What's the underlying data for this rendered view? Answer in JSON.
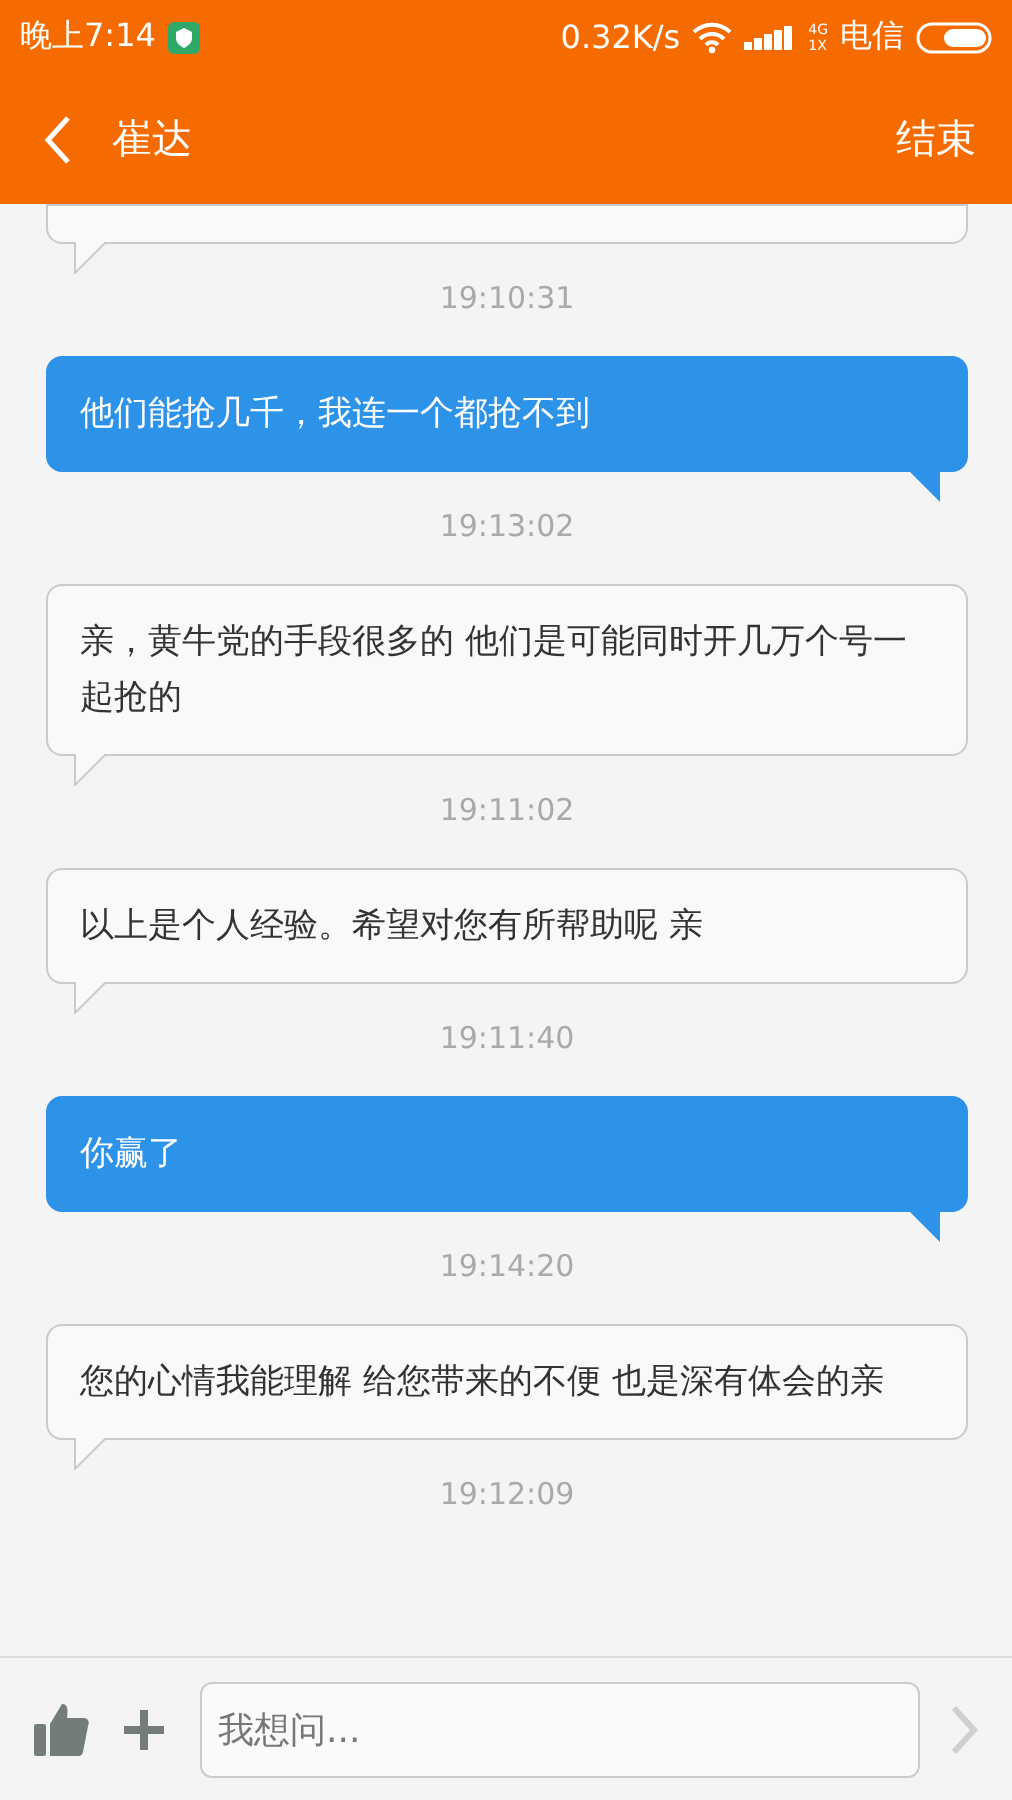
{
  "status_bar": {
    "time": "晚上7:14",
    "speed": "0.32K/s",
    "network_top": "4G",
    "network_bottom": "1X",
    "carrier": "电信"
  },
  "header": {
    "title": "崔达",
    "action": "结束"
  },
  "messages": [
    {
      "kind": "in",
      "time": "19:10:31"
    },
    {
      "kind": "out",
      "text": "他们能抢几千，我连一个都抢不到",
      "time": "19:13:02"
    },
    {
      "kind": "in",
      "text": "亲，黄牛党的手段很多的 他们是可能同时开几万个号一起抢的",
      "time": "19:11:02"
    },
    {
      "kind": "in",
      "text": "以上是个人经验。希望对您有所帮助呢 亲",
      "time": "19:11:40"
    },
    {
      "kind": "out",
      "text": "你赢了",
      "time": "19:14:20"
    },
    {
      "kind": "in",
      "text": "您的心情我能理解 给您带来的不便 也是深有体会的亲",
      "time": "19:12:09"
    }
  ],
  "composer": {
    "placeholder": "我想问..."
  }
}
